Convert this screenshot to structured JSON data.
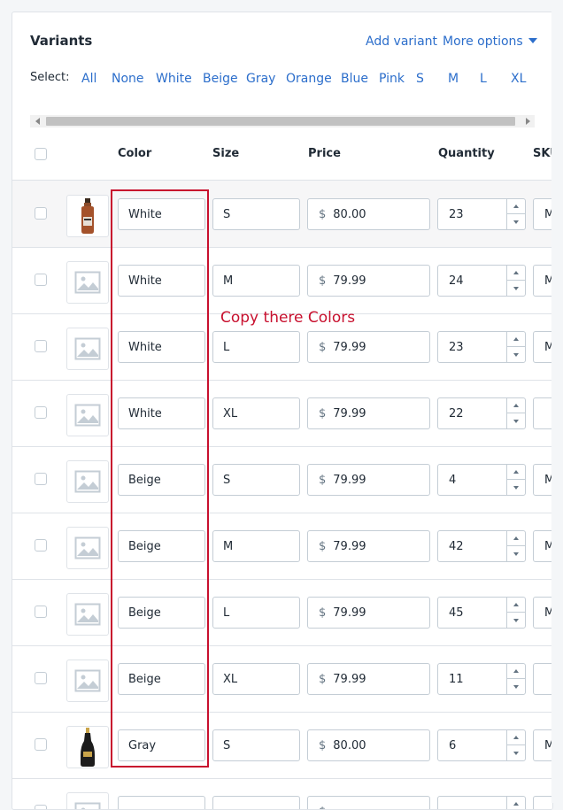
{
  "card": {
    "title": "Variants",
    "add_variant": "Add variant",
    "more_options": "More options"
  },
  "select": {
    "label": "Select:",
    "options": [
      "All",
      "None",
      "White",
      "Beige",
      "Gray",
      "Orange",
      "Blue",
      "Pink",
      "S",
      "M",
      "L",
      "XL"
    ]
  },
  "columns": {
    "color": "Color",
    "size": "Size",
    "price": "Price",
    "quantity": "Quantity",
    "sku": "SKU"
  },
  "currency_symbol": "$",
  "rows": [
    {
      "image": "product-bottle-brown",
      "color": "White",
      "size": "S",
      "price": "80.00",
      "quantity": "23",
      "sku": "M"
    },
    {
      "image": "image-placeholder-icon",
      "color": "White",
      "size": "M",
      "price": "79.99",
      "quantity": "24",
      "sku": "M"
    },
    {
      "image": "image-placeholder-icon",
      "color": "White",
      "size": "L",
      "price": "79.99",
      "quantity": "23",
      "sku": "M"
    },
    {
      "image": "image-placeholder-icon",
      "color": "White",
      "size": "XL",
      "price": "79.99",
      "quantity": "22",
      "sku": ""
    },
    {
      "image": "image-placeholder-icon",
      "color": "Beige",
      "size": "S",
      "price": "79.99",
      "quantity": "4",
      "sku": "M"
    },
    {
      "image": "image-placeholder-icon",
      "color": "Beige",
      "size": "M",
      "price": "79.99",
      "quantity": "42",
      "sku": "M"
    },
    {
      "image": "image-placeholder-icon",
      "color": "Beige",
      "size": "L",
      "price": "79.99",
      "quantity": "45",
      "sku": "M"
    },
    {
      "image": "image-placeholder-icon",
      "color": "Beige",
      "size": "XL",
      "price": "79.99",
      "quantity": "11",
      "sku": ""
    },
    {
      "image": "product-bottle-black",
      "color": "Gray",
      "size": "S",
      "price": "80.00",
      "quantity": "6",
      "sku": "M"
    },
    {
      "image": "image-placeholder-icon",
      "color": "",
      "size": "",
      "price": "",
      "quantity": "",
      "sku": ""
    }
  ],
  "annotation": {
    "text": "Copy there Colors",
    "color": "#c8102e"
  },
  "colors": {
    "link": "#2c6ecb",
    "border": "#dfe3e8",
    "row_shaded": "#f6f6f7"
  }
}
